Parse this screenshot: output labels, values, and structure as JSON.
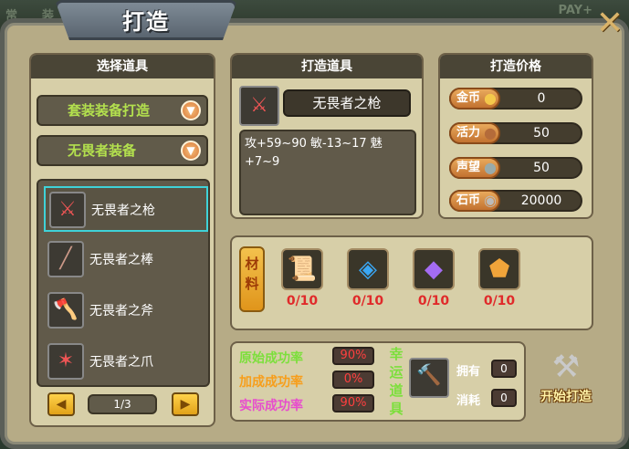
{
  "title": "打造",
  "background_text": {
    "left": "常",
    "left2": "装",
    "payplus": "PAY+"
  },
  "select_panel": {
    "header": "选择道具",
    "dropdown_set": "套装装备打造",
    "dropdown_equip": "无畏者装备",
    "items": [
      {
        "label": "无畏者之枪",
        "icon": "spear-icon"
      },
      {
        "label": "无畏者之棒",
        "icon": "club-icon"
      },
      {
        "label": "无畏者之斧",
        "icon": "axe-icon"
      },
      {
        "label": "无畏者之爪",
        "icon": "claw-icon"
      }
    ],
    "page": "1/3"
  },
  "forge_panel": {
    "header": "打造道具",
    "item_name": "无畏者之枪",
    "stats": "攻+59~90 敏-13~17 魅+7~9"
  },
  "price_panel": {
    "header": "打造价格",
    "rows": [
      {
        "label": "金币",
        "value": "0",
        "icon": "coin-icon"
      },
      {
        "label": "活力",
        "value": "50",
        "icon": "meat-icon"
      },
      {
        "label": "声望",
        "value": "50",
        "icon": "orb-icon"
      },
      {
        "label": "石币",
        "value": "20000",
        "icon": "stone-coin-icon"
      }
    ]
  },
  "materials": {
    "tag": "材料",
    "slots": [
      {
        "count": "0/10",
        "icon": "scroll-icon"
      },
      {
        "count": "0/10",
        "icon": "blue-gem-icon"
      },
      {
        "count": "0/10",
        "icon": "purple-crystal-icon"
      },
      {
        "count": "0/10",
        "icon": "amber-ore-icon"
      }
    ]
  },
  "success": {
    "base_label": "原始成功率",
    "base_value": "90%",
    "bonus_label": "加成成功率",
    "bonus_value": "0%",
    "actual_label": "实际成功率",
    "actual_value": "90%",
    "lucky_label": "幸运道具",
    "own_label": "拥有",
    "own_value": "0",
    "use_label": "消耗",
    "use_value": "0"
  },
  "start_button": "开始打造",
  "colors": {
    "selected_border": "#3fd2d8",
    "material_count": "#e02a2a",
    "rate_value": "#ff3f3f"
  }
}
